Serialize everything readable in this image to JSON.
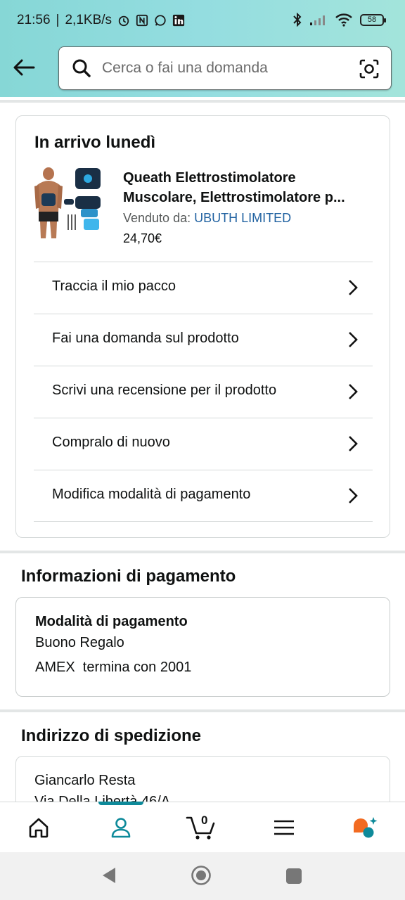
{
  "status_bar": {
    "time": "21:56",
    "speed": "2,1KB/s",
    "battery": "58"
  },
  "search": {
    "placeholder": "Cerca o fai una domanda"
  },
  "order": {
    "title": "In arrivo lunedì",
    "product_line1": "Queath Elettrostimolatore",
    "product_line2": "Muscolare, Elettrostimolatore p...",
    "seller_prefix": "Venduto da: ",
    "seller_name": "UBUTH LIMITED",
    "price": "24,70€",
    "actions": [
      {
        "label": "Traccia il mio pacco"
      },
      {
        "label": "Fai una domanda sul prodotto"
      },
      {
        "label": "Scrivi una recensione per il prodotto"
      },
      {
        "label": "Compralo di nuovo"
      },
      {
        "label": "Modifica modalità di pagamento"
      }
    ]
  },
  "payment": {
    "section_title": "Informazioni di pagamento",
    "method_heading": "Modalità di pagamento",
    "line1": "Buono Regalo",
    "line2": "AMEX  termina con 2001"
  },
  "shipping": {
    "section_title": "Indirizzo di spedizione",
    "name": "Giancarlo Resta",
    "address": "Via Della Libertà 46/A"
  },
  "tabbar": {
    "cart_count": "0",
    "active_tab": "account"
  },
  "colors": {
    "accent_teal": "#0e8a9a",
    "link_blue": "#2162a1",
    "header_gradient_start": "#86d7d6",
    "header_gradient_end": "#a3e4db",
    "rufus_orange": "#f26b21"
  }
}
